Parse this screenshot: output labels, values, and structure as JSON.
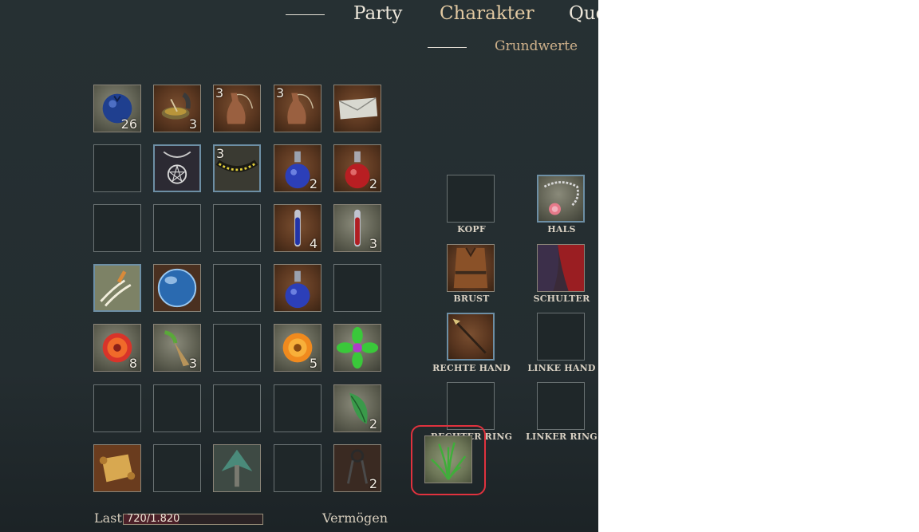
{
  "tabs": {
    "party": "Party",
    "charakter": "Charakter",
    "quests_partial": "Que"
  },
  "subtabs": {
    "grundwerte": "Grundwerte"
  },
  "inventory": [
    [
      {
        "icon": "blueberry-icon",
        "count": "26"
      },
      {
        "icon": "cooking-pot-icon",
        "count": "3"
      },
      {
        "icon": "waterskin-icon",
        "count": "3"
      },
      {
        "icon": "waterskin-icon",
        "count": "3"
      },
      {
        "icon": "letter-icon",
        "count": ""
      }
    ],
    [
      {
        "icon": "",
        "count": ""
      },
      {
        "icon": "pentagram-amulet-icon",
        "count": ""
      },
      {
        "icon": "gold-bead-necklace-icon",
        "count": "3"
      },
      {
        "icon": "blue-potion-icon",
        "count": "2"
      },
      {
        "icon": "red-potion-icon",
        "count": "2"
      }
    ],
    [
      {
        "icon": "",
        "count": ""
      },
      {
        "icon": "",
        "count": ""
      },
      {
        "icon": "",
        "count": ""
      },
      {
        "icon": "blue-vial-icon",
        "count": "4"
      },
      {
        "icon": "red-vial-icon",
        "count": "3"
      }
    ],
    [
      {
        "icon": "claw-strike-icon",
        "count": ""
      },
      {
        "icon": "crystal-orb-icon",
        "count": ""
      },
      {
        "icon": "",
        "count": ""
      },
      {
        "icon": "blue-potion-icon",
        "count": ""
      },
      {
        "icon": "",
        "count": ""
      }
    ],
    [
      {
        "icon": "red-flower-icon",
        "count": "8"
      },
      {
        "icon": "root-herb-icon",
        "count": "3"
      },
      {
        "icon": "",
        "count": ""
      },
      {
        "icon": "orange-flower-icon",
        "count": "5"
      },
      {
        "icon": "green-flower-icon",
        "count": ""
      }
    ],
    [
      {
        "icon": "",
        "count": ""
      },
      {
        "icon": "",
        "count": ""
      },
      {
        "icon": "",
        "count": ""
      },
      {
        "icon": "",
        "count": ""
      },
      {
        "icon": "leaf-herb-icon",
        "count": "2"
      }
    ],
    [
      {
        "icon": "scroll-icon",
        "count": ""
      },
      {
        "icon": "",
        "count": ""
      },
      {
        "icon": "arrowhead-icon",
        "count": ""
      },
      {
        "icon": "",
        "count": ""
      },
      {
        "icon": "keys-icon",
        "count": "2"
      }
    ]
  ],
  "equipment": {
    "kopf": "KOPF",
    "hals": "HALS",
    "brust": "BRUST",
    "schulter": "SCHULTER",
    "rechte_hand": "RECHTE HAND",
    "linke_hand": "LINKE HAND",
    "rechter_ring": "RECHTER RING",
    "linker_ring": "LINKER RING"
  },
  "dragged_item": {
    "icon": "grass-herb-icon"
  },
  "footer": {
    "last_label": "Last",
    "load_text": "720/1.820",
    "load_fraction": 0.396,
    "wealth_label": "Vermögen"
  },
  "colors": {
    "highlight": "#e0323e",
    "load_fill": "#4b2028"
  }
}
